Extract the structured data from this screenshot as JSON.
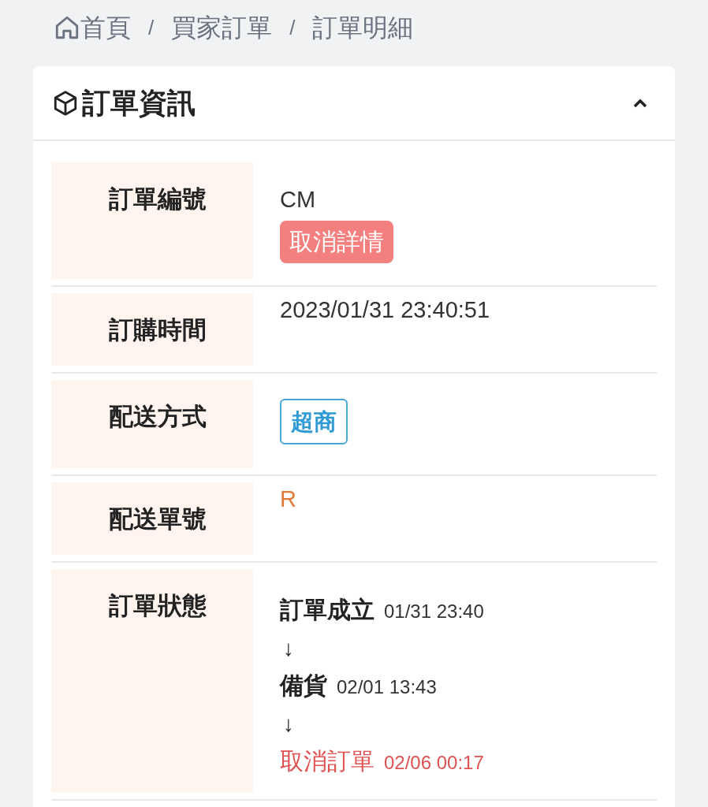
{
  "breadcrumb": [
    {
      "label": "首頁",
      "kind": "home"
    },
    {
      "label": "買家訂單",
      "kind": "link"
    },
    {
      "label": "訂單明細",
      "kind": "current"
    }
  ],
  "breadcrumb_separator": "/",
  "card": {
    "title": "訂單資訊",
    "expanded": true
  },
  "rows": [
    {
      "label": "訂單編號",
      "kind": "order",
      "value": "CM",
      "button": "取消詳情"
    },
    {
      "label": "訂購時間",
      "kind": "text",
      "value": "2023/01/31 23:40:51"
    },
    {
      "label": "配送方式",
      "kind": "tag",
      "value": "超商"
    },
    {
      "label": "配送單號",
      "kind": "tracking",
      "value": "R"
    },
    {
      "label": "訂單狀態",
      "kind": "timeline",
      "steps": [
        {
          "kind": "step",
          "label": "訂單成立",
          "time": "01/31 23:40",
          "cancelled": false
        },
        {
          "kind": "arrow",
          "symbol": "↓"
        },
        {
          "kind": "step",
          "label": "備貨",
          "time": "02/01 13:43",
          "cancelled": false
        },
        {
          "kind": "arrow",
          "symbol": "↓"
        },
        {
          "kind": "step",
          "label": "取消訂單",
          "time": "02/06 00:17",
          "cancelled": true
        }
      ]
    }
  ]
}
